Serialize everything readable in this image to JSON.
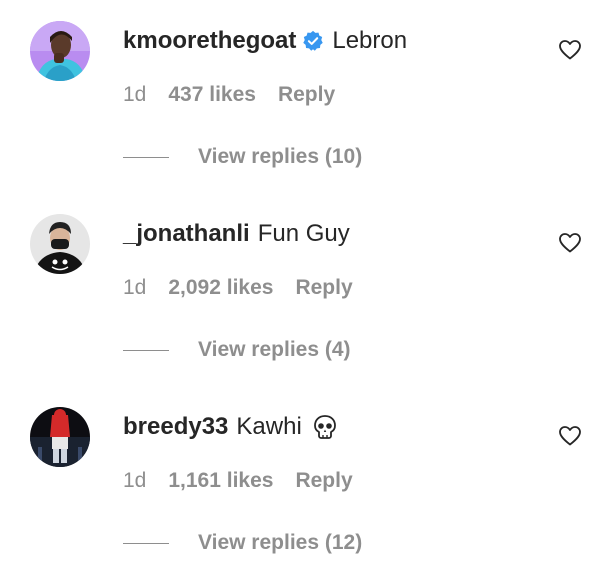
{
  "comments": [
    {
      "username": "kmoorethegoat",
      "verified": true,
      "text": "Lebron",
      "emoji": "",
      "ago": "1d",
      "likes": "437 likes",
      "reply": "Reply",
      "view_replies": "View replies (10)"
    },
    {
      "username": "_jonathanli",
      "verified": false,
      "text": "Fun Guy",
      "emoji": "",
      "ago": "1d",
      "likes": "2,092 likes",
      "reply": "Reply",
      "view_replies": "View replies (4)"
    },
    {
      "username": "breedy33",
      "verified": false,
      "text": "Kawhi",
      "emoji": "skull-emoji",
      "ago": "1d",
      "likes": "1,161 likes",
      "reply": "Reply",
      "view_replies": "View replies (12)"
    }
  ],
  "colors": {
    "primary_text": "#262626",
    "secondary_text": "#8e8e8e",
    "verified_blue": "#3897f0"
  }
}
